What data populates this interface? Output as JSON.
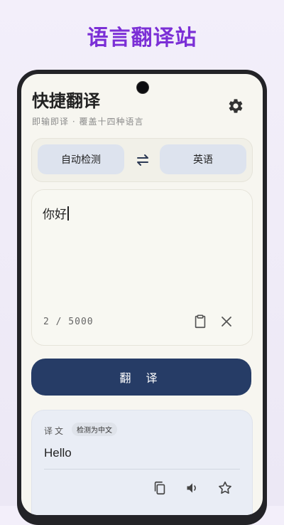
{
  "promo": {
    "title": "语言翻译站"
  },
  "app": {
    "title": "快捷翻译",
    "subtitle": "即输即译 · 覆盖十四种语言"
  },
  "icons": {
    "settings": "gear-icon",
    "swap": "swap-arrows-icon",
    "paste": "clipboard-icon",
    "clear": "close-icon",
    "copy": "copy-icon",
    "speak": "speaker-icon",
    "favorite": "star-icon"
  },
  "language_bar": {
    "source": "自动检测",
    "target": "英语"
  },
  "input": {
    "value": "你好",
    "char_count": "2 / 5000"
  },
  "translate_button": {
    "label": "翻 译"
  },
  "result": {
    "label": "译文",
    "detected_badge": "检测为中文",
    "text": "Hello"
  },
  "colors": {
    "promo_title": "#7b2fd6",
    "primary_button": "#263c66",
    "lang_chip": "#dde3ee",
    "result_card": "#e9edf5"
  }
}
